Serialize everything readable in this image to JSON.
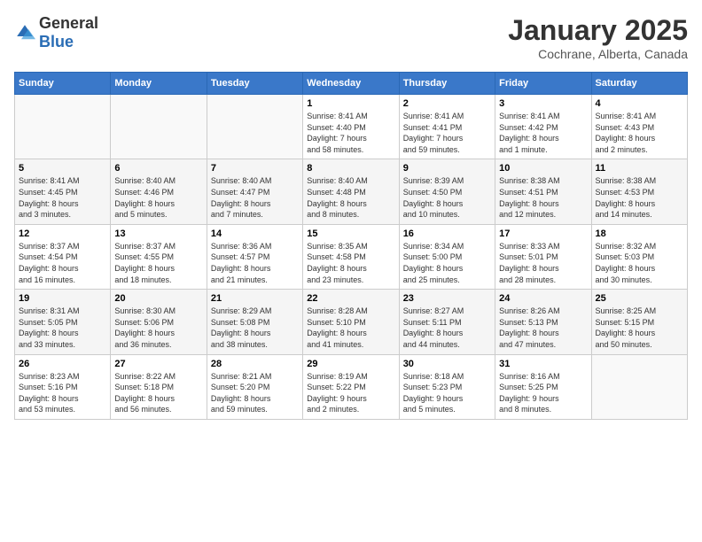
{
  "header": {
    "logo": {
      "general": "General",
      "blue": "Blue"
    },
    "title": "January 2025",
    "location": "Cochrane, Alberta, Canada"
  },
  "weekdays": [
    "Sunday",
    "Monday",
    "Tuesday",
    "Wednesday",
    "Thursday",
    "Friday",
    "Saturday"
  ],
  "weeks": [
    [
      {
        "day": "",
        "content": ""
      },
      {
        "day": "",
        "content": ""
      },
      {
        "day": "",
        "content": ""
      },
      {
        "day": "1",
        "content": "Sunrise: 8:41 AM\nSunset: 4:40 PM\nDaylight: 7 hours\nand 58 minutes."
      },
      {
        "day": "2",
        "content": "Sunrise: 8:41 AM\nSunset: 4:41 PM\nDaylight: 7 hours\nand 59 minutes."
      },
      {
        "day": "3",
        "content": "Sunrise: 8:41 AM\nSunset: 4:42 PM\nDaylight: 8 hours\nand 1 minute."
      },
      {
        "day": "4",
        "content": "Sunrise: 8:41 AM\nSunset: 4:43 PM\nDaylight: 8 hours\nand 2 minutes."
      }
    ],
    [
      {
        "day": "5",
        "content": "Sunrise: 8:41 AM\nSunset: 4:45 PM\nDaylight: 8 hours\nand 3 minutes."
      },
      {
        "day": "6",
        "content": "Sunrise: 8:40 AM\nSunset: 4:46 PM\nDaylight: 8 hours\nand 5 minutes."
      },
      {
        "day": "7",
        "content": "Sunrise: 8:40 AM\nSunset: 4:47 PM\nDaylight: 8 hours\nand 7 minutes."
      },
      {
        "day": "8",
        "content": "Sunrise: 8:40 AM\nSunset: 4:48 PM\nDaylight: 8 hours\nand 8 minutes."
      },
      {
        "day": "9",
        "content": "Sunrise: 8:39 AM\nSunset: 4:50 PM\nDaylight: 8 hours\nand 10 minutes."
      },
      {
        "day": "10",
        "content": "Sunrise: 8:38 AM\nSunset: 4:51 PM\nDaylight: 8 hours\nand 12 minutes."
      },
      {
        "day": "11",
        "content": "Sunrise: 8:38 AM\nSunset: 4:53 PM\nDaylight: 8 hours\nand 14 minutes."
      }
    ],
    [
      {
        "day": "12",
        "content": "Sunrise: 8:37 AM\nSunset: 4:54 PM\nDaylight: 8 hours\nand 16 minutes."
      },
      {
        "day": "13",
        "content": "Sunrise: 8:37 AM\nSunset: 4:55 PM\nDaylight: 8 hours\nand 18 minutes."
      },
      {
        "day": "14",
        "content": "Sunrise: 8:36 AM\nSunset: 4:57 PM\nDaylight: 8 hours\nand 21 minutes."
      },
      {
        "day": "15",
        "content": "Sunrise: 8:35 AM\nSunset: 4:58 PM\nDaylight: 8 hours\nand 23 minutes."
      },
      {
        "day": "16",
        "content": "Sunrise: 8:34 AM\nSunset: 5:00 PM\nDaylight: 8 hours\nand 25 minutes."
      },
      {
        "day": "17",
        "content": "Sunrise: 8:33 AM\nSunset: 5:01 PM\nDaylight: 8 hours\nand 28 minutes."
      },
      {
        "day": "18",
        "content": "Sunrise: 8:32 AM\nSunset: 5:03 PM\nDaylight: 8 hours\nand 30 minutes."
      }
    ],
    [
      {
        "day": "19",
        "content": "Sunrise: 8:31 AM\nSunset: 5:05 PM\nDaylight: 8 hours\nand 33 minutes."
      },
      {
        "day": "20",
        "content": "Sunrise: 8:30 AM\nSunset: 5:06 PM\nDaylight: 8 hours\nand 36 minutes."
      },
      {
        "day": "21",
        "content": "Sunrise: 8:29 AM\nSunset: 5:08 PM\nDaylight: 8 hours\nand 38 minutes."
      },
      {
        "day": "22",
        "content": "Sunrise: 8:28 AM\nSunset: 5:10 PM\nDaylight: 8 hours\nand 41 minutes."
      },
      {
        "day": "23",
        "content": "Sunrise: 8:27 AM\nSunset: 5:11 PM\nDaylight: 8 hours\nand 44 minutes."
      },
      {
        "day": "24",
        "content": "Sunrise: 8:26 AM\nSunset: 5:13 PM\nDaylight: 8 hours\nand 47 minutes."
      },
      {
        "day": "25",
        "content": "Sunrise: 8:25 AM\nSunset: 5:15 PM\nDaylight: 8 hours\nand 50 minutes."
      }
    ],
    [
      {
        "day": "26",
        "content": "Sunrise: 8:23 AM\nSunset: 5:16 PM\nDaylight: 8 hours\nand 53 minutes."
      },
      {
        "day": "27",
        "content": "Sunrise: 8:22 AM\nSunset: 5:18 PM\nDaylight: 8 hours\nand 56 minutes."
      },
      {
        "day": "28",
        "content": "Sunrise: 8:21 AM\nSunset: 5:20 PM\nDaylight: 8 hours\nand 59 minutes."
      },
      {
        "day": "29",
        "content": "Sunrise: 8:19 AM\nSunset: 5:22 PM\nDaylight: 9 hours\nand 2 minutes."
      },
      {
        "day": "30",
        "content": "Sunrise: 8:18 AM\nSunset: 5:23 PM\nDaylight: 9 hours\nand 5 minutes."
      },
      {
        "day": "31",
        "content": "Sunrise: 8:16 AM\nSunset: 5:25 PM\nDaylight: 9 hours\nand 8 minutes."
      },
      {
        "day": "",
        "content": ""
      }
    ]
  ]
}
